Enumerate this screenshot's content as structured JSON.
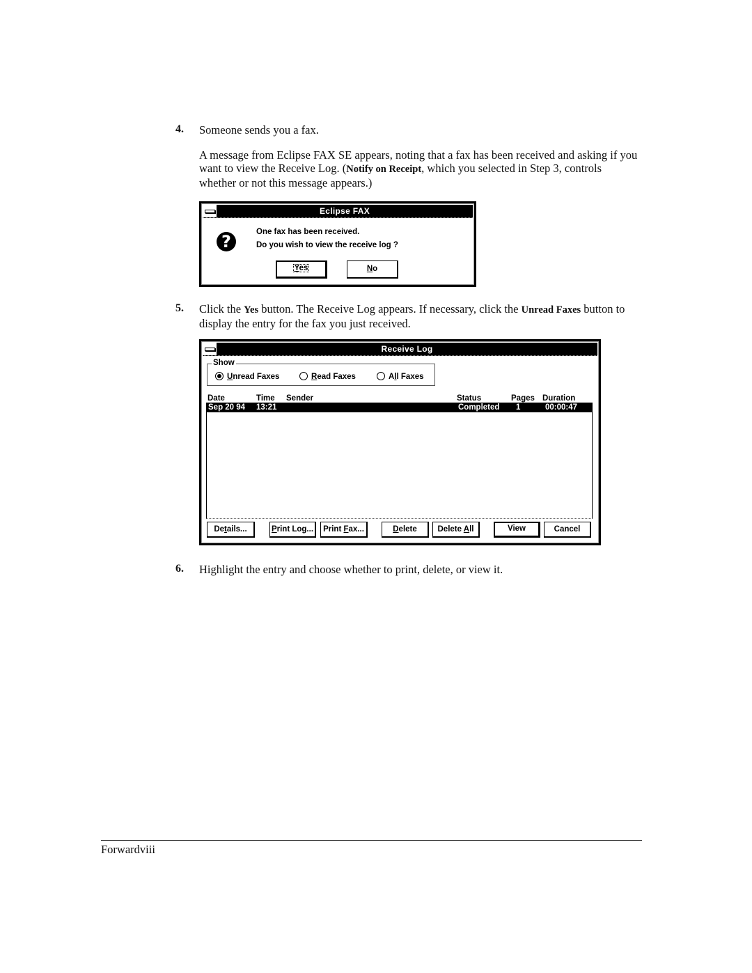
{
  "steps": [
    {
      "number": "4.",
      "heading": "Someone sends you a fax.",
      "body_parts": {
        "p1": "A message from Eclipse FAX SE appears, noting that a fax has been received and asking if  you want to view the Receive Log. (",
        "bold": "Notify on Receipt",
        "p2": ", which you selected in Step 3, controls whether or not this message appears.)"
      }
    },
    {
      "number": "5.",
      "parts": {
        "p1": "Click the ",
        "bold1": "Yes",
        "p2": " button. The Receive Log appears. If necessary, click the ",
        "bold2": "Unread Faxes",
        "p3": " button to display the entry for the fax you just received."
      }
    },
    {
      "number": "6.",
      "text": "Highlight the entry and choose whether to print, delete, or view it."
    }
  ],
  "message_dialog": {
    "title": "Eclipse FAX",
    "icon": "question-icon",
    "icon_glyph": "?",
    "line1": "One fax has been received.",
    "line2": "Do you wish to view the receive log ?",
    "buttons": {
      "yes": {
        "mnemonic": "Y",
        "rest": "es"
      },
      "no": {
        "mnemonic": "N",
        "rest": "o"
      }
    }
  },
  "receive_log": {
    "title": "Receive Log",
    "show_group": {
      "label": "Show",
      "options": [
        {
          "pre": "",
          "mnemonic": "U",
          "rest": "nread Faxes",
          "selected": true
        },
        {
          "pre": "",
          "mnemonic": "R",
          "rest": "ead Faxes",
          "selected": false
        },
        {
          "pre": "A",
          "mnemonic": "l",
          "rest": "l Faxes",
          "selected": false
        }
      ]
    },
    "columns": [
      "Date",
      "Time",
      "Sender",
      "Status",
      "Pages",
      "Duration"
    ],
    "rows": [
      {
        "date": "Sep 20  94",
        "time": "13:21",
        "sender": "",
        "status": "Completed",
        "pages": "1",
        "duration": "00:00:47",
        "selected": true
      }
    ],
    "buttons": [
      {
        "pre": "De",
        "mnemonic": "t",
        "rest": "ails..."
      },
      {
        "pre": "",
        "mnemonic": "P",
        "rest": "rint Log..."
      },
      {
        "pre": "Print ",
        "mnemonic": "F",
        "rest": "ax..."
      },
      {
        "pre": "",
        "mnemonic": "D",
        "rest": "elete"
      },
      {
        "pre": "Delete ",
        "mnemonic": "A",
        "rest": "ll"
      },
      {
        "pre": "View",
        "mnemonic": "",
        "rest": ""
      },
      {
        "pre": "Cancel",
        "mnemonic": "",
        "rest": ""
      }
    ]
  },
  "footer": {
    "text": "Forwardviii"
  }
}
